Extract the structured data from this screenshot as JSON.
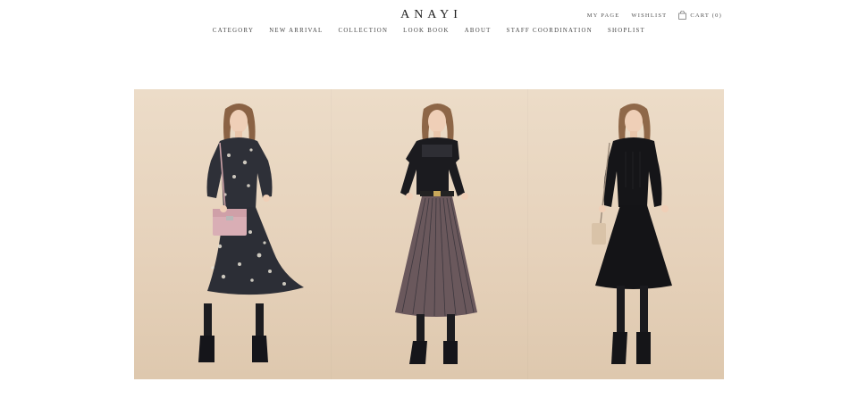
{
  "brand": {
    "logo": "ANAYI"
  },
  "util_nav": {
    "my_page": "MY PAGE",
    "wishlist": "WISHLIST",
    "cart": "CART (0)",
    "cart_icon": "shopping-bag-icon"
  },
  "main_nav": {
    "items": [
      {
        "label": "CATEGORY"
      },
      {
        "label": "NEW ARRIVAL"
      },
      {
        "label": "COLLECTION"
      },
      {
        "label": "LOOK BOOK"
      },
      {
        "label": "ABOUT"
      },
      {
        "label": "STAFF COORDINATION"
      },
      {
        "label": "SHOPLIST"
      }
    ]
  },
  "hero": {
    "images": [
      {
        "name": "floral-dress-look",
        "description_icon": "model-photo"
      },
      {
        "name": "pleated-skirt-look",
        "description_icon": "model-photo"
      },
      {
        "name": "black-dress-look",
        "description_icon": "model-photo"
      }
    ]
  },
  "colors": {
    "background": "#ffffff",
    "hero_beige": "#e6d2bb",
    "text": "#2a2a2a"
  }
}
